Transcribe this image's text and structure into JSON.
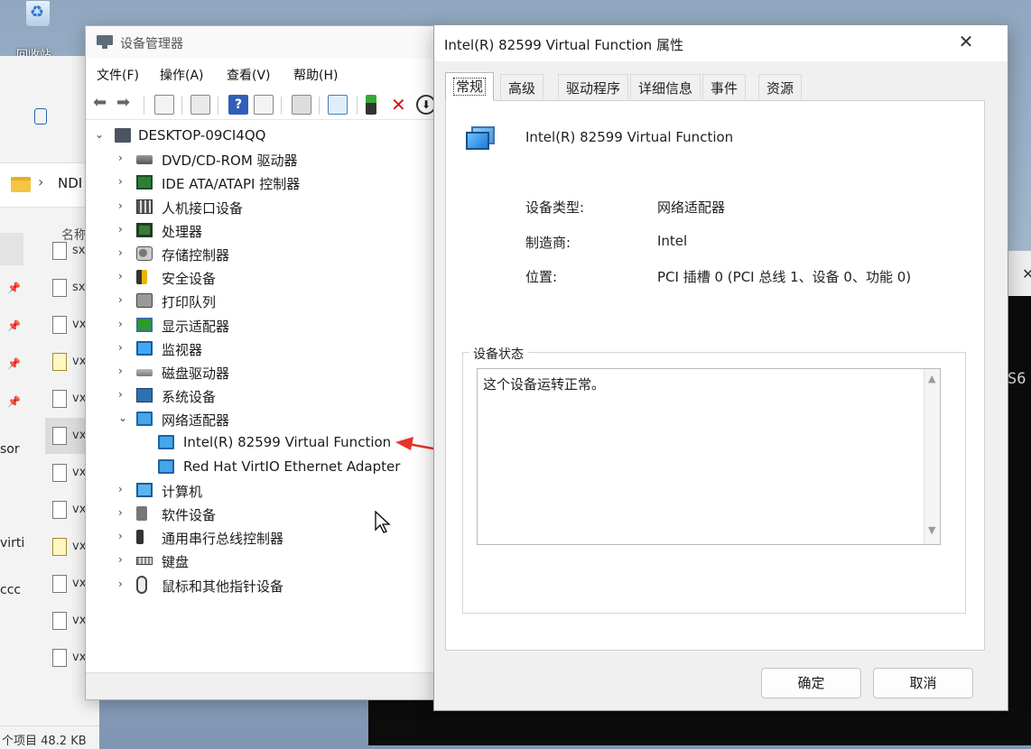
{
  "desktop": {
    "recycle_label": "回收站"
  },
  "explorer": {
    "addr_text": "NDI",
    "col_name": "名称",
    "side_labels": [
      "sor",
      "virti",
      "ccc"
    ],
    "files": [
      "sx",
      "sx",
      "vx",
      "vx",
      "vx",
      "vx",
      "vx",
      "vx",
      "vx",
      "vx",
      "vx",
      "vx"
    ],
    "status": "个项目  48.2 KB"
  },
  "terminal": {
    "text": "S6"
  },
  "devmgr": {
    "title": "设备管理器",
    "menu": [
      "文件(F)",
      "操作(A)",
      "查看(V)",
      "帮助(H)"
    ],
    "root": "DESKTOP-09CI4QQ",
    "tree": [
      {
        "label": "DVD/CD-ROM 驱动器",
        "icon": "dvd-drive-icon",
        "cls": "ic-disk"
      },
      {
        "label": "IDE ATA/ATAPI 控制器",
        "icon": "ide-controller-icon",
        "cls": "ic-chip"
      },
      {
        "label": "人机接口设备",
        "icon": "hid-icon",
        "cls": "ic-hid"
      },
      {
        "label": "处理器",
        "icon": "processor-icon",
        "cls": "ic-cpu"
      },
      {
        "label": "存储控制器",
        "icon": "storage-controller-icon",
        "cls": "ic-store"
      },
      {
        "label": "安全设备",
        "icon": "security-device-icon",
        "cls": "ic-sec"
      },
      {
        "label": "打印队列",
        "icon": "print-queue-icon",
        "cls": "ic-print"
      },
      {
        "label": "显示适配器",
        "icon": "display-adapter-icon",
        "cls": "ic-display"
      },
      {
        "label": "监视器",
        "icon": "monitor-icon",
        "cls": "ic-monitor"
      },
      {
        "label": "磁盘驱动器",
        "icon": "disk-drive-icon",
        "cls": "ic-hdd"
      },
      {
        "label": "系统设备",
        "icon": "system-device-icon",
        "cls": "ic-sys"
      },
      {
        "label": "网络适配器",
        "icon": "network-adapter-icon",
        "cls": "ic-net",
        "expanded": true,
        "children": [
          {
            "label": "Intel(R) 82599 Virtual Function",
            "icon": "network-adapter-icon",
            "cls": "ic-net"
          },
          {
            "label": "Red Hat VirtIO Ethernet Adapter",
            "icon": "network-adapter-icon",
            "cls": "ic-net"
          }
        ]
      },
      {
        "label": "计算机",
        "icon": "computer-icon",
        "cls": "ic-comp"
      },
      {
        "label": "软件设备",
        "icon": "software-device-icon",
        "cls": "ic-soft"
      },
      {
        "label": "通用串行总线控制器",
        "icon": "usb-controller-icon",
        "cls": "ic-usb"
      },
      {
        "label": "键盘",
        "icon": "keyboard-icon",
        "cls": "ic-kbd"
      },
      {
        "label": "鼠标和其他指针设备",
        "icon": "mouse-icon",
        "cls": "ic-mouse"
      }
    ]
  },
  "props": {
    "title": "Intel(R) 82599 Virtual Function 属性",
    "tabs": [
      "常规",
      "高级",
      "驱动程序",
      "详细信息",
      "事件",
      "资源"
    ],
    "active_tab": 0,
    "device_name": "Intel(R) 82599 Virtual Function",
    "fields": [
      {
        "key": "设备类型:",
        "value": "网络适配器"
      },
      {
        "key": "制造商:",
        "value": "Intel"
      },
      {
        "key": "位置:",
        "value": "PCI 插槽 0 (PCI 总线 1、设备 0、功能 0)"
      }
    ],
    "status_legend": "设备状态",
    "status_text": "这个设备运转正常。",
    "ok_label": "确定",
    "cancel_label": "取消"
  },
  "colors": {
    "annotation_arrow": "#e8322a",
    "accent": "#1c7ad6"
  }
}
